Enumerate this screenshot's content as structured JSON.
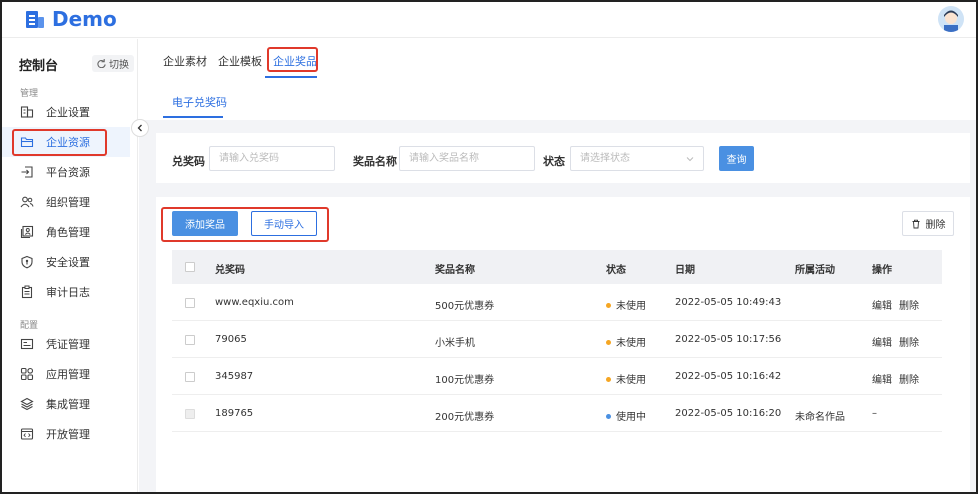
{
  "app": {
    "logo_text": "Demo"
  },
  "sidebar": {
    "console_title": "控制台",
    "switch_label": "切换",
    "section_manage": "管理",
    "section_config": "配置",
    "items": [
      {
        "label": "企业设置",
        "icon": "building-icon"
      },
      {
        "label": "企业资源",
        "icon": "folder-icon",
        "active": true
      },
      {
        "label": "平台资源",
        "icon": "import-icon"
      },
      {
        "label": "组织管理",
        "icon": "users-icon"
      },
      {
        "label": "角色管理",
        "icon": "role-icon"
      },
      {
        "label": "安全设置",
        "icon": "shield-icon"
      },
      {
        "label": "审计日志",
        "icon": "clipboard-icon"
      },
      {
        "label": "凭证管理",
        "icon": "credential-icon"
      },
      {
        "label": "应用管理",
        "icon": "apps-icon"
      },
      {
        "label": "集成管理",
        "icon": "layers-icon"
      },
      {
        "label": "开放管理",
        "icon": "code-window-icon"
      }
    ]
  },
  "tabs": {
    "items": [
      "企业素材",
      "企业模板",
      "企业奖品"
    ],
    "active": "企业奖品",
    "sub_tab": "电子兑奖码"
  },
  "filters": {
    "code_label": "兑奖码",
    "code_placeholder": "请输入兑奖码",
    "prize_label": "奖品名称",
    "prize_placeholder": "请输入奖品名称",
    "status_label": "状态",
    "status_placeholder": "请选择状态",
    "query_label": "查询"
  },
  "toolbar": {
    "add_label": "添加奖品",
    "import_label": "手动导入",
    "delete_label": "删除"
  },
  "table": {
    "headers": [
      "兑奖码",
      "奖品名称",
      "状态",
      "日期",
      "所属活动",
      "操作"
    ],
    "rows": [
      {
        "code": "www.eqxiu.com",
        "prize": "500元优惠券",
        "status": "未使用",
        "date": "2022-05-05 10:49:43",
        "activity": "",
        "edit": "编辑",
        "delete": "删除"
      },
      {
        "code": "79065",
        "prize": "小米手机",
        "status": "未使用",
        "date": "2022-05-05 10:17:56",
        "activity": "",
        "edit": "编辑",
        "delete": "删除"
      },
      {
        "code": "345987",
        "prize": "100元优惠券",
        "status": "未使用",
        "date": "2022-05-05 10:16:42",
        "activity": "",
        "edit": "编辑",
        "delete": "删除"
      },
      {
        "code": "189765",
        "prize": "200元优惠券",
        "status": "使用中",
        "date": "2022-05-05 10:16:20",
        "activity": "未命名作品",
        "op_placeholder": "–"
      }
    ]
  },
  "colors": {
    "primary": "#2d6fe0",
    "unused_dot": "#f5a623",
    "inuse_dot": "#4a90e2",
    "highlight": "#e0392b"
  }
}
